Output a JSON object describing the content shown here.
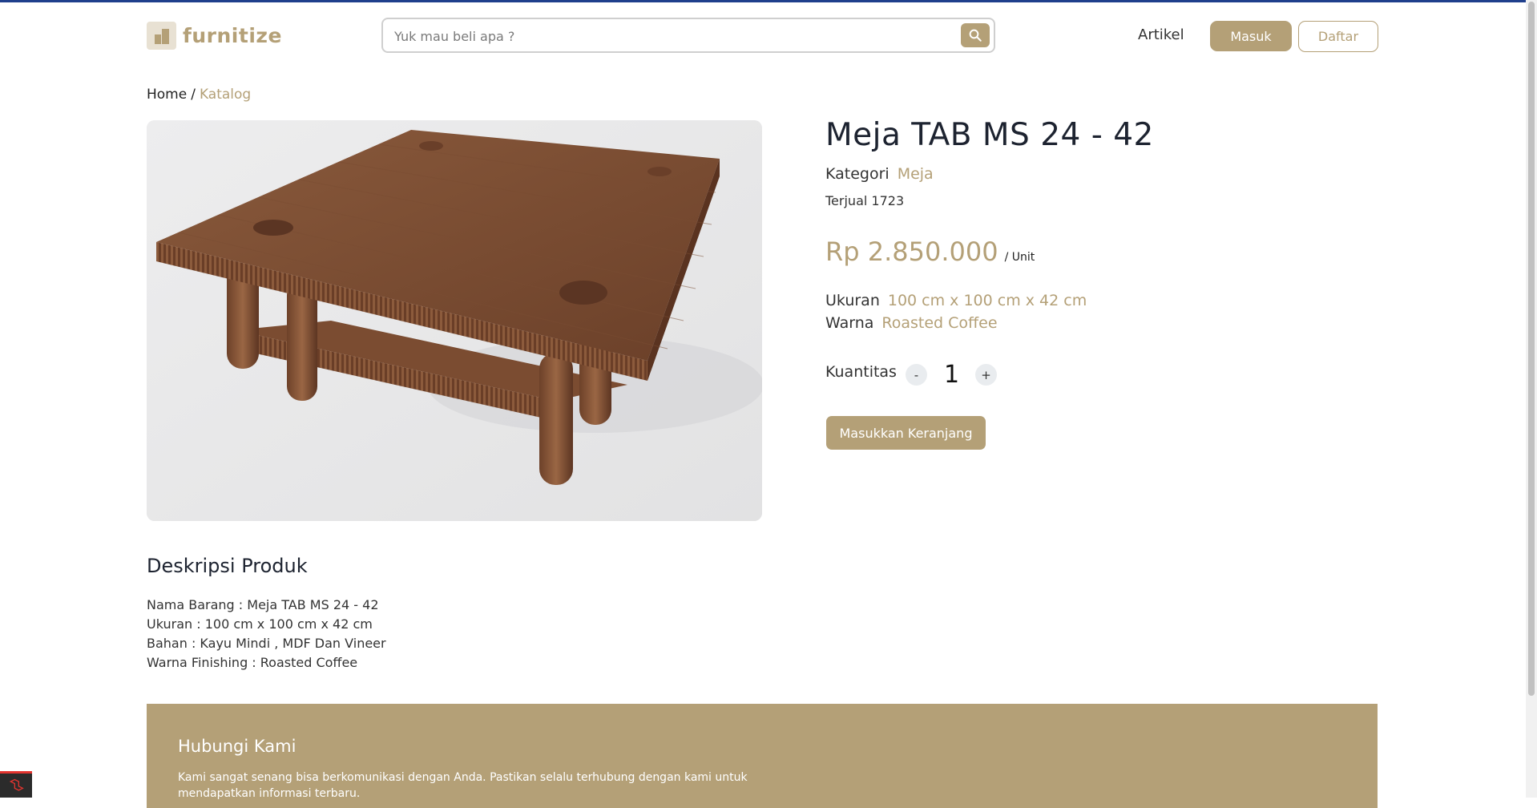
{
  "header": {
    "brand": "furnitize",
    "search_placeholder": "Yuk mau beli apa ?",
    "nav_artikel": "Artikel",
    "login_label": "Masuk",
    "register_label": "Daftar"
  },
  "breadcrumb": {
    "home": "Home",
    "separator": "/",
    "current": "Katalog"
  },
  "product": {
    "title": "Meja TAB MS 24 - 42",
    "kategori_label": "Kategori",
    "kategori_value": "Meja",
    "terjual": "Terjual 1723",
    "price": "Rp 2.850.000",
    "price_unit": "/ Unit",
    "ukuran_label": "Ukuran",
    "ukuran_value": "100 cm x 100 cm x 42 cm",
    "warna_label": "Warna",
    "warna_value": "Roasted Coffee",
    "kuantitas_label": "Kuantitas",
    "qty_minus": "-",
    "qty_value": "1",
    "qty_plus": "+",
    "cart_button": "Masukkan Keranjang"
  },
  "description": {
    "title": "Deskripsi Produk",
    "lines": [
      "Nama Barang : Meja TAB MS 24 - 42",
      "Ukuran : 100 cm x 100 cm x 42 cm",
      "Bahan : Kayu Mindi , MDF Dan Vineer",
      "Warna Finishing : Roasted Coffee"
    ]
  },
  "footer": {
    "title": "Hubungi Kami",
    "text": "Kami sangat senang bisa berkomunikasi dengan Anda. Pastikan selalu terhubung dengan kami untuk mendapatkan informasi terbaru."
  },
  "colors": {
    "accent": "#b4a077",
    "text": "#333333",
    "topline": "#1f3f8c"
  },
  "icons": {
    "search": "search-icon",
    "logo": "logo-icon",
    "debug": "laravel-debugbar-icon"
  }
}
